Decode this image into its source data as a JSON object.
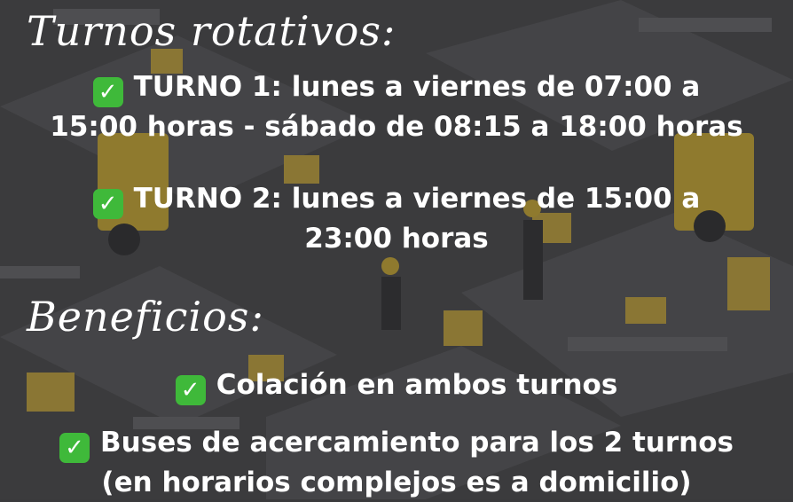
{
  "headings": {
    "shifts": "Turnos rotativos:",
    "benefits": "Beneficios:"
  },
  "shifts": [
    {
      "line1": "TURNO 1: lunes a viernes de 07:00 a",
      "line2": "15:00 horas - sábado de 08:15 a 18:00 horas"
    },
    {
      "line1": "TURNO 2: lunes a viernes de 15:00 a",
      "line2": "23:00 horas"
    }
  ],
  "benefits": [
    {
      "line1": "Colación en ambos turnos"
    },
    {
      "line1": "Buses de acercamiento para los 2 turnos",
      "line2": "(en horarios complejos es a domicilio)"
    }
  ],
  "icons": {
    "check": "check-mark-button-icon"
  },
  "colors": {
    "check_green": "#3fb93a",
    "text": "#ffffff",
    "background": "#3a3a3c",
    "accent_yellow": "#c9a23a"
  }
}
